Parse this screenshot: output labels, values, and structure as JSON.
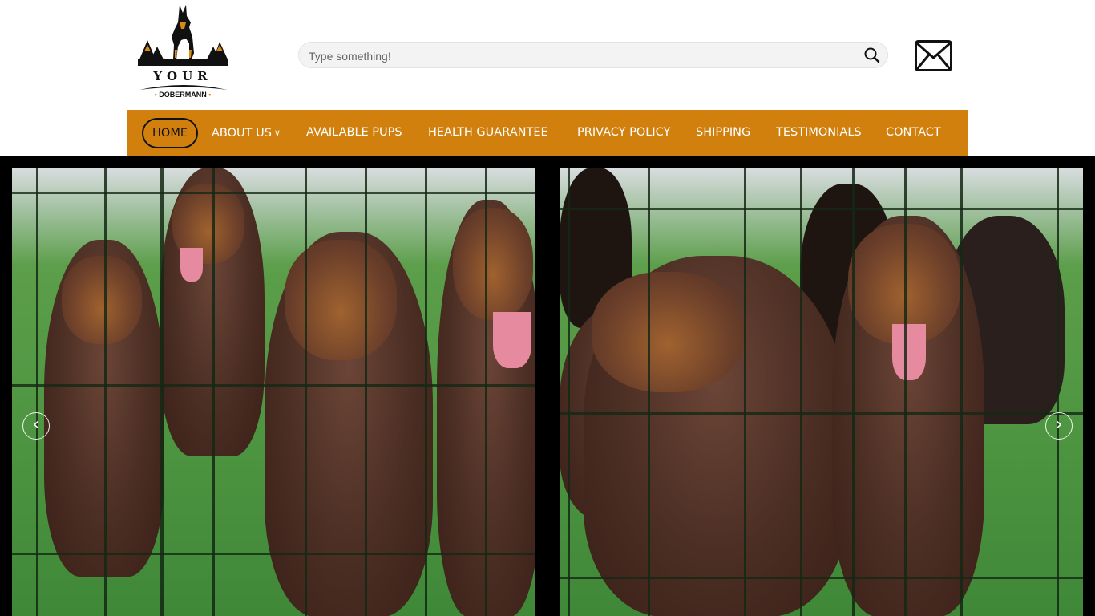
{
  "logo": {
    "line1": "YOUR",
    "line2": "DOBERMANN",
    "dot": "•"
  },
  "search": {
    "placeholder": "Type something!",
    "icon": "search-icon"
  },
  "mail": {
    "icon": "envelope-icon"
  },
  "nav": {
    "items": [
      {
        "label": "HOME",
        "active": true
      },
      {
        "label": "ABOUT US",
        "has_dropdown": true
      },
      {
        "label": "AVAILABLE PUPS"
      },
      {
        "label": "HEALTH GUARANTEE"
      },
      {
        "label": "PRIVACY POLICY"
      },
      {
        "label": "SHIPPING"
      },
      {
        "label": "TESTIMONIALS"
      },
      {
        "label": "CONTACT"
      }
    ],
    "caret": "∨"
  },
  "slider": {
    "prev": "‹",
    "next": "›",
    "prev_icon": "chevron-left-icon",
    "next_icon": "chevron-right-icon"
  },
  "colors": {
    "accent": "#d1800e",
    "hero_bg": "#000000"
  }
}
